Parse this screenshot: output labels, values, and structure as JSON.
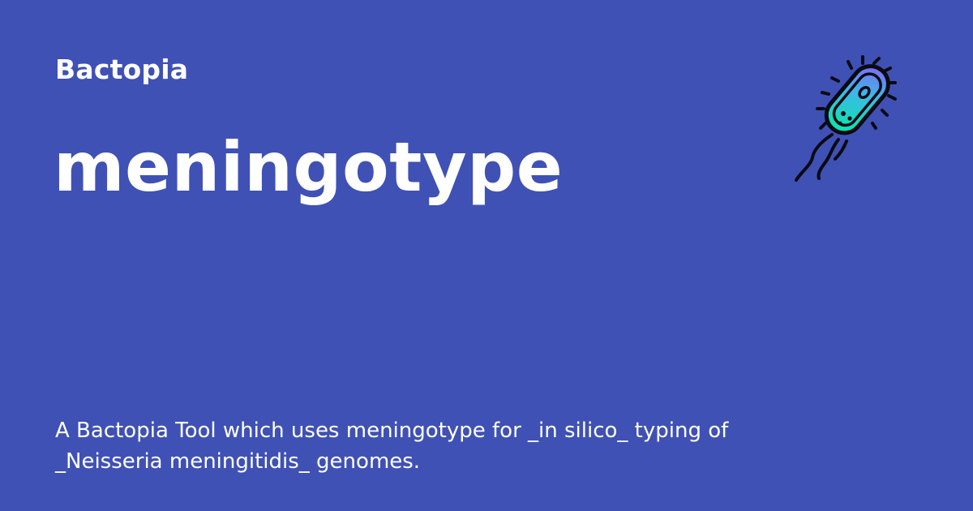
{
  "card": {
    "site_name": "Bactopia",
    "title": "meningotype",
    "description": "A Bactopia Tool which uses meningotype for _in silico_ typing of _Neisseria meningitidis_ genomes."
  },
  "icon": "bacterium-icon",
  "colors": {
    "background": "#3f51b5",
    "text": "#ffffff",
    "icon_gradient_top": "#8a5cf6",
    "icon_gradient_bottom": "#10e0b0"
  }
}
